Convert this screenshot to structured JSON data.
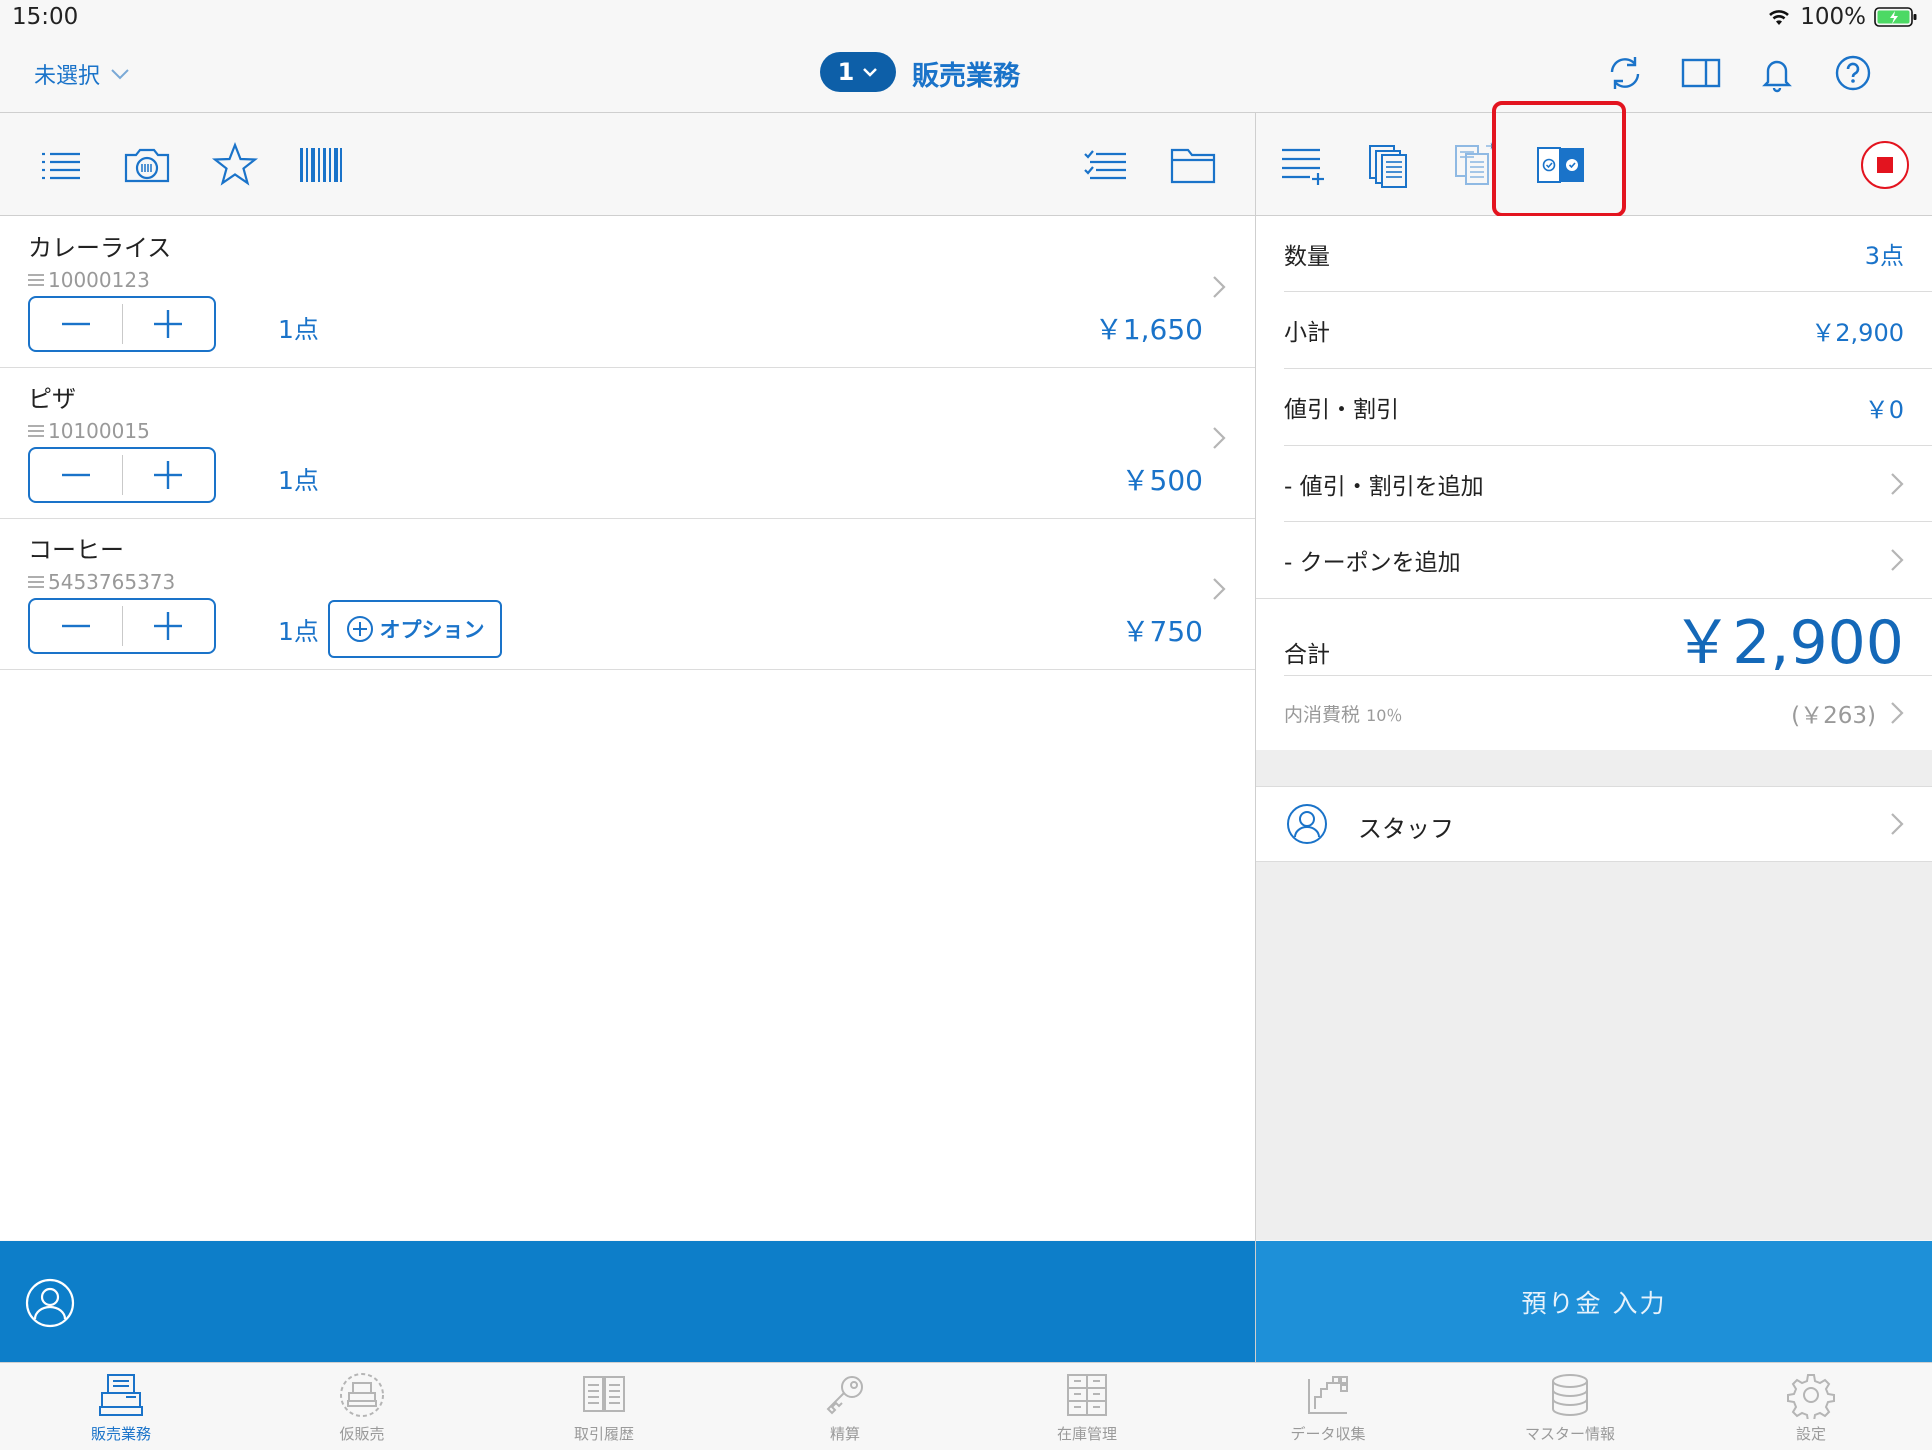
{
  "status": {
    "time": "15:00",
    "battery": "100%"
  },
  "nav": {
    "store": "未選択",
    "register_number": "1",
    "title": "販売業務",
    "icons": [
      "sync-icon",
      "split-view-icon",
      "bell-icon",
      "help-icon"
    ]
  },
  "left_toolbar": {
    "icons": [
      "list-icon",
      "camera-scan-icon",
      "star-icon",
      "barcode-icon",
      "checklist-icon",
      "folder-icon"
    ]
  },
  "right_toolbar": {
    "icons": [
      "add-line-icon",
      "copy-documents-icon",
      "transfer-documents-icon",
      "toggle-select-icon",
      "stop-icon"
    ],
    "highlight_color": "#e3141f"
  },
  "items": [
    {
      "name": "カレーライス",
      "code": "10000123",
      "qty": "1点",
      "price": "￥1,650",
      "option": null
    },
    {
      "name": "ピザ",
      "code": "10100015",
      "qty": "1点",
      "price": "￥500",
      "option": null
    },
    {
      "name": "コーヒー",
      "code": "5453765373",
      "qty": "1点",
      "price": "￥750",
      "option": "オプション"
    }
  ],
  "summary": {
    "quantity_label": "数量",
    "quantity_value": "3点",
    "subtotal_label": "小計",
    "subtotal_value": "￥2,900",
    "discount_label": "値引・割引",
    "discount_value": "￥0",
    "add_discount_label": "- 値引・割引を追加",
    "add_coupon_label": "- クーポンを追加",
    "total_label": "合計",
    "total_value": "￥2,900",
    "tax_label": "内消費税",
    "tax_rate": "10％",
    "tax_value": "(￥263)",
    "staff_label": "スタッフ"
  },
  "actions": {
    "deposit_label": "預り金 入力"
  },
  "tabs": [
    {
      "label": "販売業務",
      "icon": "register-icon",
      "active": true
    },
    {
      "label": "仮販売",
      "icon": "temp-sale-icon",
      "active": false
    },
    {
      "label": "取引履歴",
      "icon": "history-icon",
      "active": false
    },
    {
      "label": "精算",
      "icon": "key-icon",
      "active": false
    },
    {
      "label": "在庫管理",
      "icon": "inventory-icon",
      "active": false
    },
    {
      "label": "データ収集",
      "icon": "data-collection-icon",
      "active": false
    },
    {
      "label": "マスター情報",
      "icon": "database-icon",
      "active": false
    },
    {
      "label": "設定",
      "icon": "gear-icon",
      "active": false
    }
  ],
  "colors": {
    "accent": "#1a73c9",
    "action_bar": "#0d7ec9",
    "deposit_bar": "#1e90d8"
  }
}
